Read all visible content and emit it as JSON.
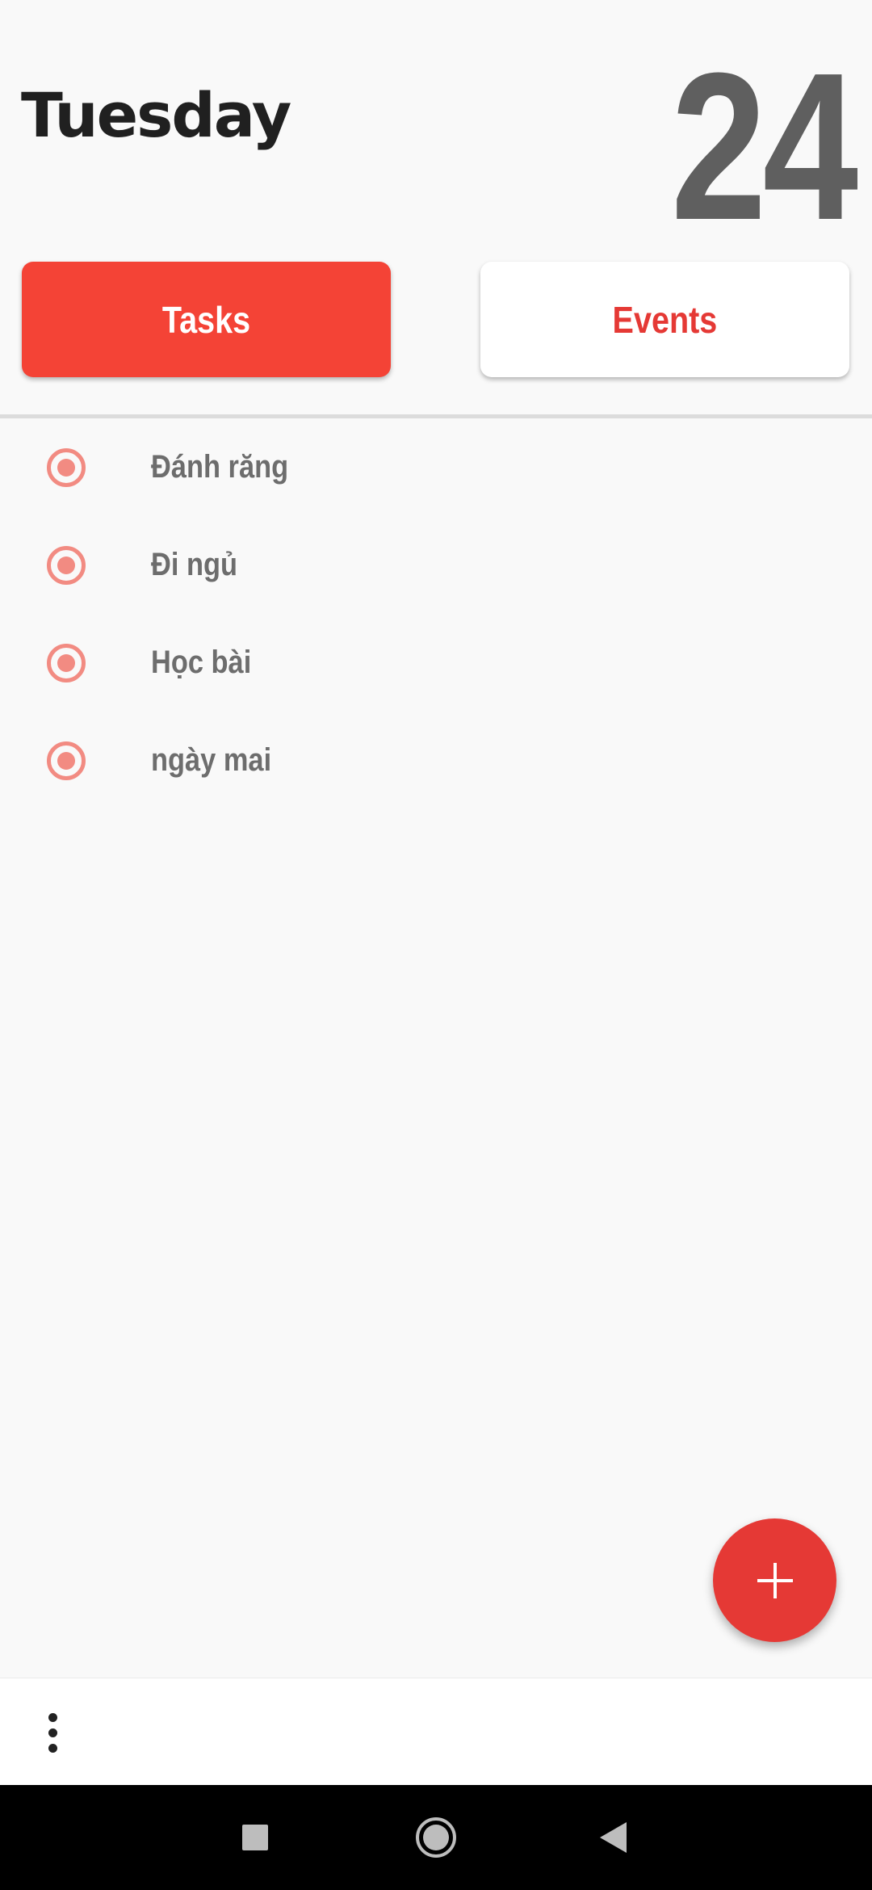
{
  "header": {
    "day_name": "Tuesday",
    "day_number": "24"
  },
  "tabs": [
    {
      "label": "Tasks",
      "selected": true
    },
    {
      "label": "Events",
      "selected": false
    }
  ],
  "tasks": [
    {
      "label": "Đánh răng",
      "selected": true
    },
    {
      "label": "Đi ngủ",
      "selected": true
    },
    {
      "label": "Học bài",
      "selected": true
    },
    {
      "label": "ngày mai",
      "selected": true
    }
  ],
  "icons": {
    "task_radio": "radio-checked-icon",
    "fab": "plus-icon",
    "more": "more-vertical-icon",
    "nav_recent": "square-icon",
    "nav_home": "circle-icon",
    "nav_back": "triangle-back-icon"
  },
  "colors": {
    "accent": "#f44336",
    "fab": "#e53935",
    "radio": "#f28b82",
    "day_number": "#5f5f5f",
    "task_text": "#6d6d6d"
  }
}
